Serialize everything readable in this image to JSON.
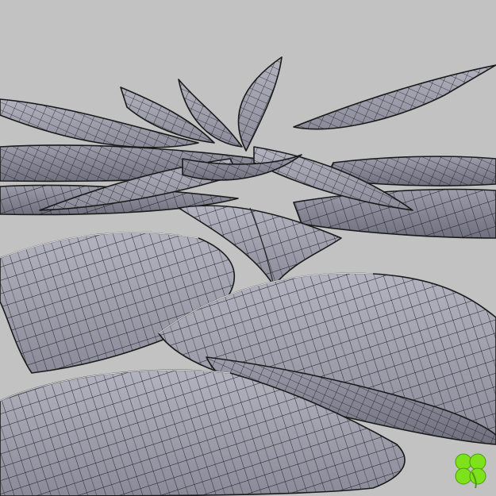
{
  "scene": {
    "subject": "wireframe-leaf-rosette",
    "background_color": "#c2c2c2",
    "surface_color": "#9a9aa8",
    "wire_color": "#1a1a1a",
    "logo_icon": "green-clover-icon",
    "logo_color": "#7ee21a"
  }
}
